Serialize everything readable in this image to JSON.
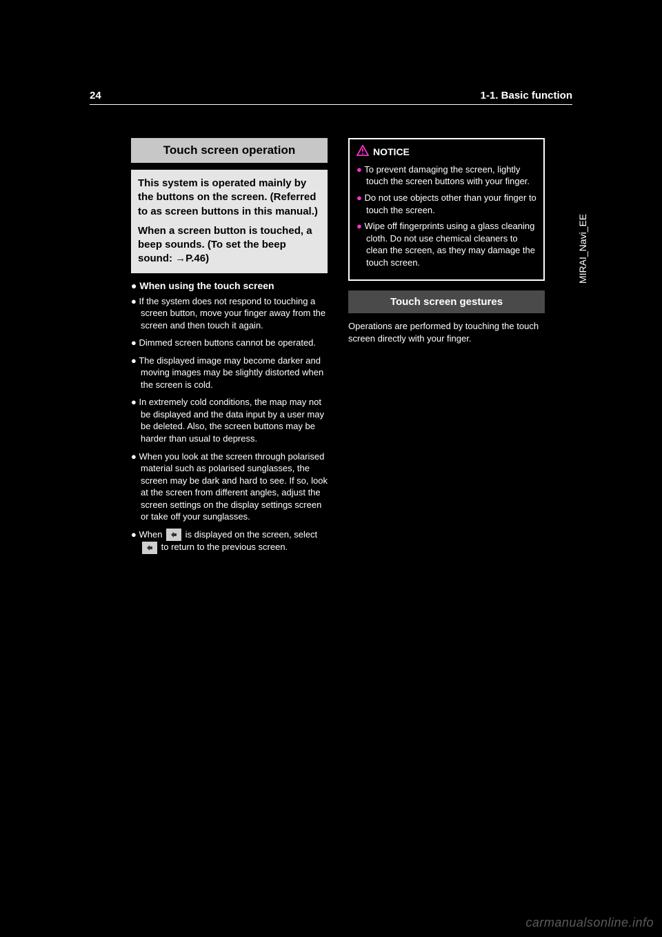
{
  "header": {
    "page_num": "24",
    "chapter": "1-1. Basic function"
  },
  "side_tab": "MIRAI_Navi_EE",
  "left": {
    "heading": "Touch screen operation",
    "intro1": "This system is operated mainly by the buttons on the screen. (Referred to as screen buttons in this manual.)",
    "intro2": "When a screen button is touched, a beep sounds. (To set the beep sound: →P.46)",
    "subhead": "When using the touch screen",
    "bullets": [
      "If the system does not respond to touching a screen button, move your finger away from the screen and then touch it again.",
      "Dimmed screen buttons cannot be operated.",
      "The displayed image may become darker and moving images may be slightly distorted when the screen is cold.",
      "In extremely cold conditions, the map may not be displayed and the data input by a user may be deleted. Also, the screen buttons may be harder than usual to depress.",
      "When you look at the screen through polarised material such as polarised sunglasses, the screen may be dark and hard to see. If so, look at the screen from different angles, adjust the screen settings on the display settings screen or take off your sunglasses.",
      "When        is displayed on the screen, select        to return to the previous screen."
    ],
    "back_icon_name": "back-arrow-icon"
  },
  "notice": {
    "title": "NOTICE",
    "bullets": [
      "To prevent damaging the screen, lightly touch the screen buttons with your finger.",
      "Do not use objects other than your finger to touch the screen.",
      "Wipe off fingerprints using a glass cleaning cloth. Do not use chemical cleaners to clean the screen, as they may damage the touch screen."
    ]
  },
  "gestures": {
    "title": "Touch screen gestures",
    "text": "Operations are performed by touching the touch screen directly with your finger."
  },
  "watermark": "carmanualsonline.info"
}
